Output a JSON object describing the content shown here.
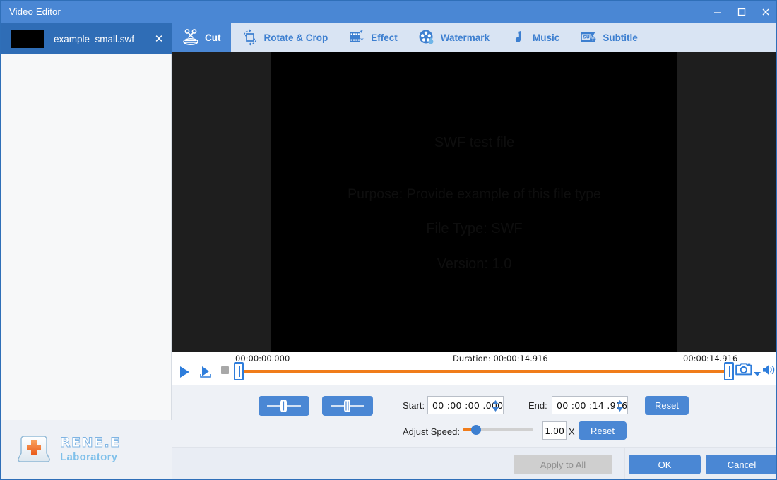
{
  "window": {
    "title": "Video Editor",
    "minimize_icon": "minimize-icon",
    "maximize_icon": "maximize-icon",
    "close_icon": "close-icon",
    "accent": "#4a87d4"
  },
  "sidebar": {
    "file": {
      "name": "example_small.swf",
      "close_label": "✕"
    }
  },
  "logo": {
    "title": "RENE.E",
    "subtitle": "Laboratory"
  },
  "toolbar": {
    "tabs": [
      {
        "label": "Cut",
        "icon": "scissors-icon",
        "active": true
      },
      {
        "label": "Rotate & Crop",
        "icon": "rotate-crop-icon",
        "active": false
      },
      {
        "label": "Effect",
        "icon": "effect-icon",
        "active": false
      },
      {
        "label": "Watermark",
        "icon": "watermark-icon",
        "active": false
      },
      {
        "label": "Music",
        "icon": "music-note-icon",
        "active": false
      },
      {
        "label": "Subtitle",
        "icon": "subtitle-icon",
        "active": false
      }
    ]
  },
  "preview": {
    "line1": "SWF test file",
    "line2": "Purpose: Provide example of this file type",
    "line3": "File Type: SWF",
    "line4": "Version: 1.0"
  },
  "timeline": {
    "start_time": "00:00:00.000",
    "duration_label": "Duration: 00:00:14.916",
    "end_time": "00:00:14.916",
    "play_icon": "play-icon",
    "play_selection_icon": "play-selection-icon",
    "stop_icon": "stop-icon",
    "left_handle_icon": "trim-handle-left-icon",
    "right_handle_icon": "trim-handle-right-icon",
    "snapshot_icon": "camera-icon",
    "snapshot_dropdown_icon": "chevron-down-icon",
    "volume_icon": "volume-icon",
    "track_color": "#f07c1a"
  },
  "controls": {
    "set_start_icon": "set-start-marker-icon",
    "set_end_icon": "set-end-marker-icon",
    "start_label": "Start:",
    "start_value": "00 :00 :00 .000",
    "end_label": "End:",
    "end_value": "00 :00 :14 .916",
    "reset_trim_label": "Reset",
    "speed_label": "Adjust Speed:",
    "speed_value": "1.00",
    "speed_unit": "X",
    "reset_speed_label": "Reset"
  },
  "footer": {
    "apply_all_label": "Apply to All",
    "ok_label": "OK",
    "cancel_label": "Cancel"
  }
}
